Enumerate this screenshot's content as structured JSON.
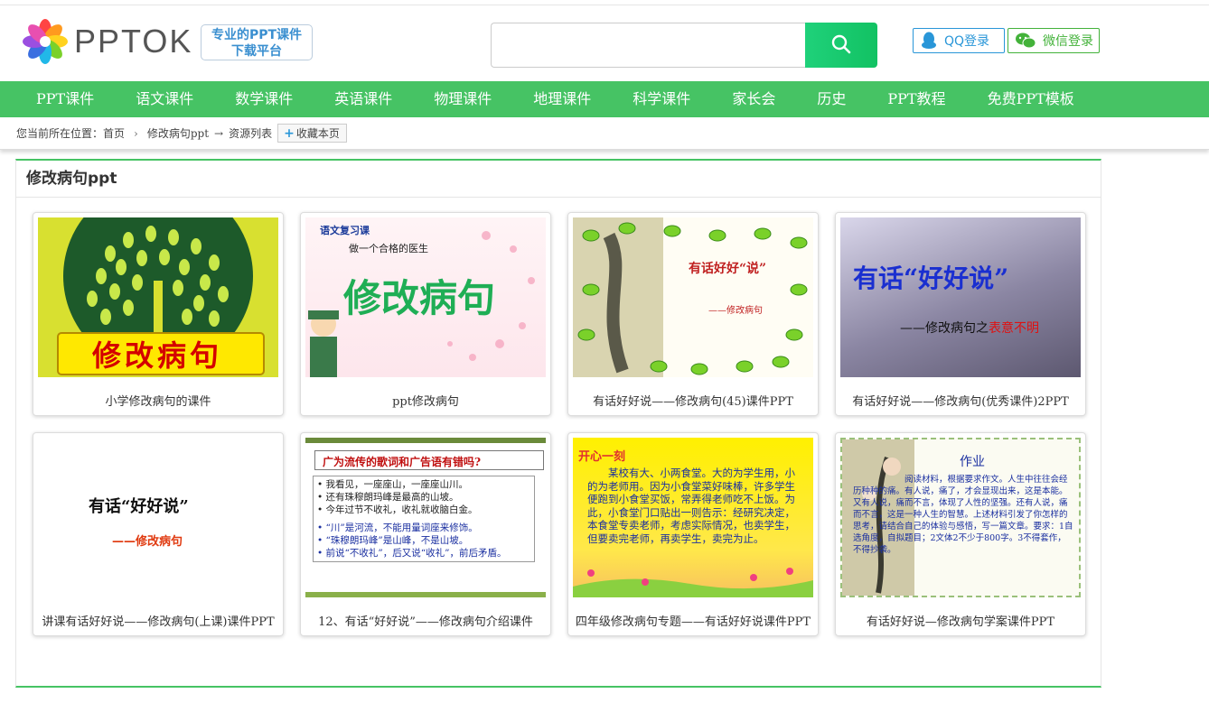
{
  "header": {
    "logo_text": "PPTOK",
    "slogan_line1": "专业的PPT课件",
    "slogan_line2": "下载平台",
    "search_placeholder": "",
    "qq_login": "QQ登录",
    "wechat_login": "微信登录"
  },
  "nav": [
    "PPT课件",
    "语文课件",
    "数学课件",
    "英语课件",
    "物理课件",
    "地理课件",
    "科学课件",
    "家长会",
    "历史",
    "PPT教程",
    "免费PPT模板"
  ],
  "breadcrumb": {
    "prefix": "您当前所在位置：",
    "home": "首页",
    "category": "修改病句ppt",
    "arrow": "→",
    "current": "资源列表",
    "favorite": "收藏本页"
  },
  "panel_title": "修改病句ppt",
  "cards": [
    {
      "caption": "小学修改病句的课件",
      "thumb_text": "修改病句"
    },
    {
      "caption": "ppt修改病句",
      "thumb_text": "修改病句",
      "thumb_sub1": "语文复习课",
      "thumb_sub2": "做一个合格的医生"
    },
    {
      "caption": "有话好好说——修改病句(45)课件PPT",
      "thumb_text": "有话好好“说”",
      "thumb_sub1": "——修改病句"
    },
    {
      "caption": "有话好好说——修改病句(优秀课件)2PPT",
      "thumb_text": "有话“好好说”",
      "thumb_sub1": "——修改病句之",
      "thumb_sub2": "表意不明"
    },
    {
      "caption": "讲课有话好好说——修改病句(上课)课件PPT",
      "thumb_text": "有话“好好说”",
      "thumb_sub1": "——修改病句"
    },
    {
      "caption": "12、有话“好好说”——修改病句介绍课件",
      "thumb_text": "广为流传的歌词和广告语有错吗?",
      "thumb_lines": [
        "我看见，一座座山，一座座山川。",
        "还有珠穆朗玛峰是最高的山坡。",
        "今年过节不收礼，收礼就收脑白金。",
        "“川”是河流，不能用量词座来修饰。",
        "“珠穆朗玛峰”是山峰，不是山坡。",
        "前说“不收礼”，后又说“收礼”，前后矛盾。"
      ]
    },
    {
      "caption": "四年级修改病句专题——有话好好说课件PPT",
      "thumb_text": "开心一刻",
      "thumb_body": "某校有大、小两食堂。大的为学生用，小的为老师用。因为小食堂菜好味棒，许多学生便跑到小食堂买饭，常弄得老师吃不上饭。为此，小食堂门口贴出一则告示：经研究决定，本食堂专卖老师，考虑实际情况，也卖学生，但要卖完老师，再卖学生，卖完为止。"
    },
    {
      "caption": "有话好好说—修改病句学案课件PPT",
      "thumb_text": "作业",
      "thumb_body": "阅读材料，根据要求作文。人生中往往会经历种种的痛。有人说，痛了，才会显现出来，这是本能。又有人说，痛而不言，体现了人性的坚强。还有人说，痛而不言，这是一种人生的智慧。上述材料引发了你怎样的思考，请结合自己的体验与感悟，写一篇文章。要求：1自选角度，自拟题目；2文体2不少于800字。3不得套作，不得抄袭。"
    }
  ],
  "colors": {
    "green": "#46c364",
    "qq_blue": "#2996d8",
    "wechat_green": "#43b23a"
  }
}
